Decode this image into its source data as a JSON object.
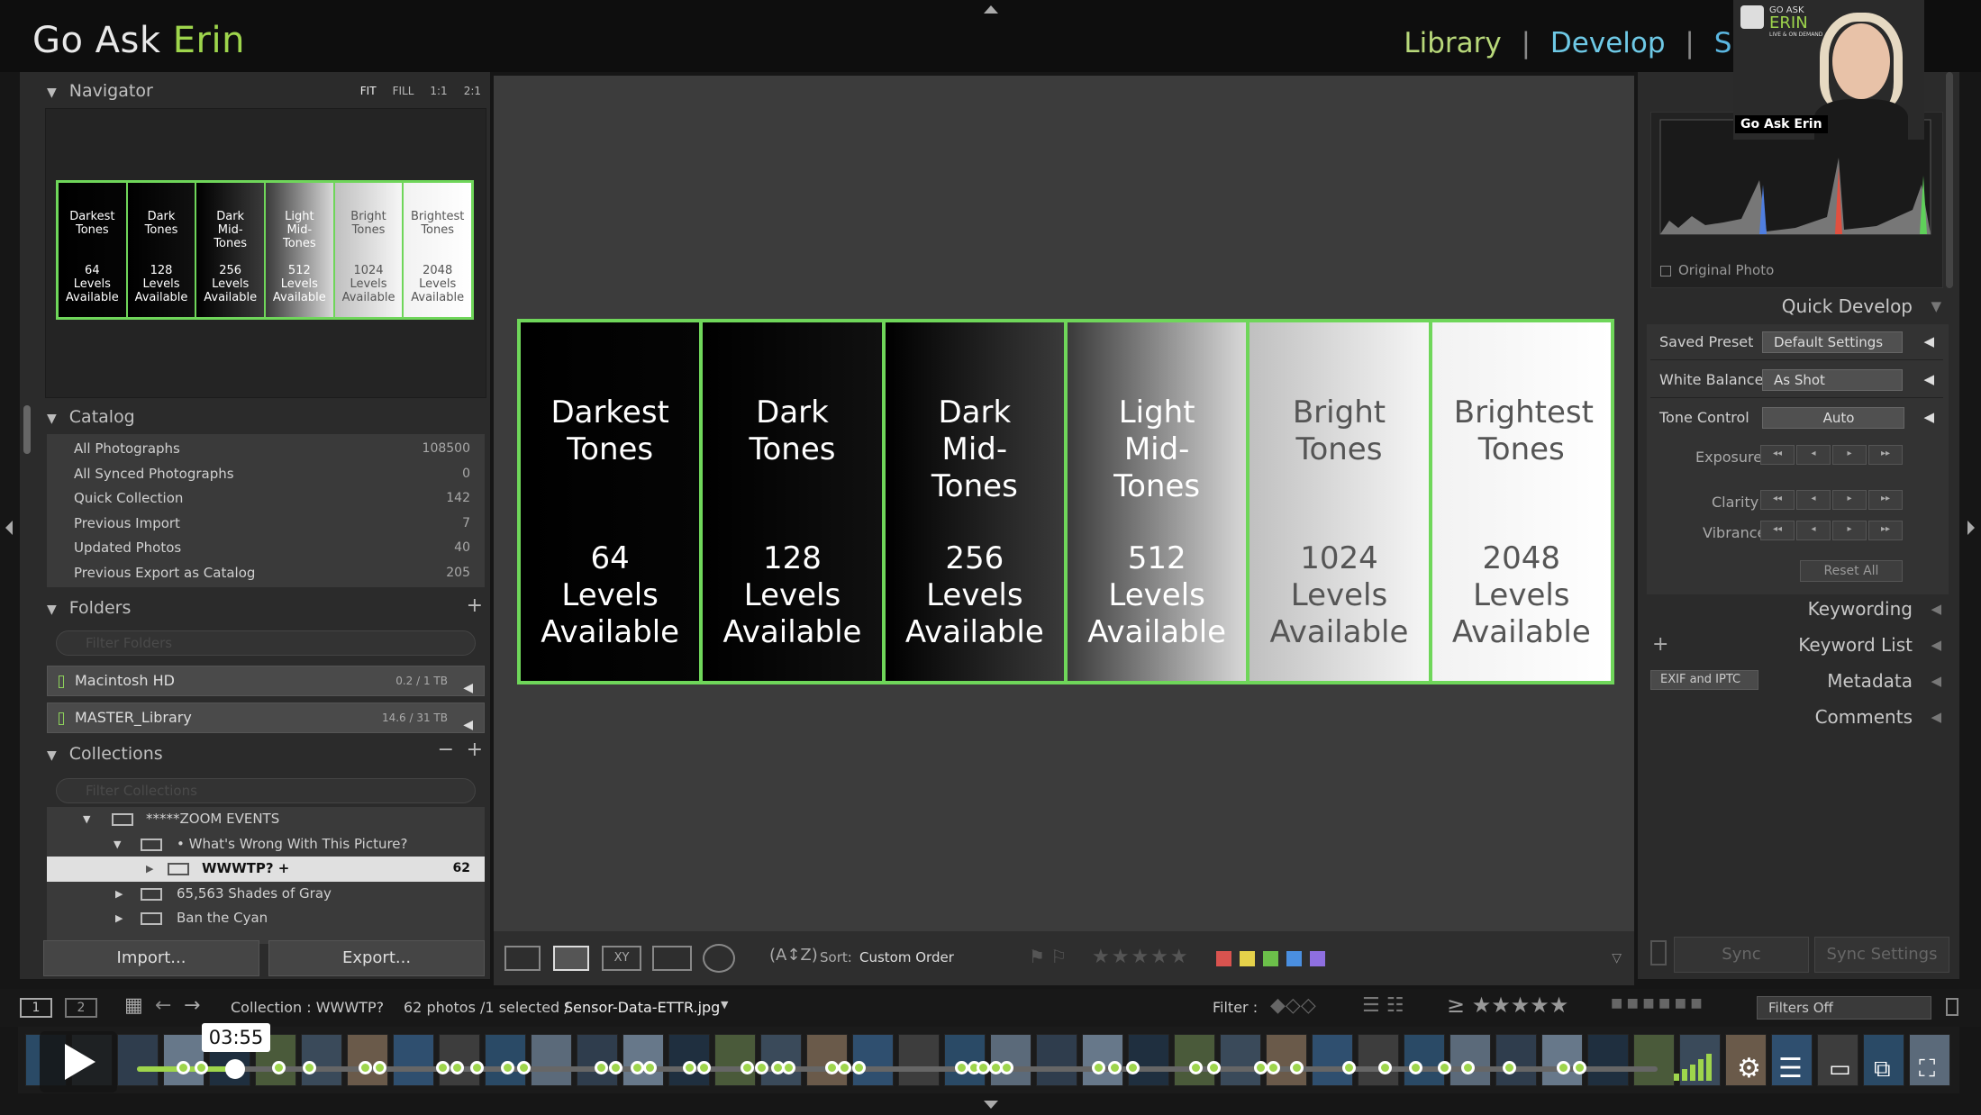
{
  "header": {
    "brand_prefix": "Go Ask",
    "brand_accent": "Erin",
    "modules": [
      "Library",
      "Develop",
      "Sl"
    ],
    "separator": "|"
  },
  "navigator": {
    "title": "Navigator",
    "zoom_options": [
      "FIT",
      "FILL",
      "1:1",
      "2:1"
    ],
    "thumb_columns": [
      {
        "name": "Darkest Tones",
        "levels": "64 Levels Available"
      },
      {
        "name": "Dark Tones",
        "levels": "128 Levels Available"
      },
      {
        "name": "Dark Mid-Tones",
        "levels": "256 Levels Available"
      },
      {
        "name": "Light Mid-Tones",
        "levels": "512 Levels Available"
      },
      {
        "name": "Bright Tones",
        "levels": "1024 Levels Available"
      },
      {
        "name": "Brightest Tones",
        "levels": "2048 Levels Available"
      }
    ]
  },
  "catalog": {
    "title": "Catalog",
    "items": [
      {
        "label": "All Photographs",
        "count": "108500"
      },
      {
        "label": "All Synced Photographs",
        "count": "0"
      },
      {
        "label": "Quick Collection",
        "count": "142"
      },
      {
        "label": "Previous Import",
        "count": "7"
      },
      {
        "label": "Updated Photos",
        "count": "40"
      },
      {
        "label": "Previous Export as Catalog",
        "count": "205"
      }
    ]
  },
  "folders": {
    "title": "Folders",
    "filter_placeholder": "Filter Folders",
    "items": [
      {
        "label": "Macintosh HD",
        "size": "0.2 / 1 TB"
      },
      {
        "label": "MASTER_Library",
        "size": "14.6 / 31 TB"
      }
    ]
  },
  "collections": {
    "title": "Collections",
    "filter_placeholder": "Filter Collections",
    "items": [
      {
        "label": "*****ZOOM EVENTS",
        "count": ""
      },
      {
        "label": "• What's Wrong With This Picture?",
        "count": ""
      },
      {
        "label": "WWWTP? +",
        "count": "62"
      },
      {
        "label": "65,563 Shades of Gray",
        "count": ""
      },
      {
        "label": "Ban the Cyan",
        "count": ""
      }
    ]
  },
  "buttons": {
    "import": "Import...",
    "export": "Export..."
  },
  "main_image": {
    "columns": [
      {
        "name": "Darkest Tones",
        "l1": "64",
        "l2": "Levels",
        "l3": "Available"
      },
      {
        "name": "Dark Tones",
        "l1": "128",
        "l2": "Levels",
        "l3": "Available"
      },
      {
        "name": "Dark Mid-Tones",
        "l1": "256",
        "l2": "Levels",
        "l3": "Available"
      },
      {
        "name": "Light Mid-Tones",
        "l1": "512",
        "l2": "Levels",
        "l3": "Available"
      },
      {
        "name": "Bright Tones",
        "l1": "1024",
        "l2": "Levels",
        "l3": "Available"
      },
      {
        "name": "Brightest Tones",
        "l1": "2048",
        "l2": "Levels",
        "l3": "Available"
      }
    ]
  },
  "toolbar": {
    "sort_label": "Sort:",
    "sort_value": "Custom Order",
    "color_labels": [
      "#d9534f",
      "#e5d14a",
      "#6cc04a",
      "#4a8fe0",
      "#8e6fe0"
    ]
  },
  "right_panel": {
    "original_photo": "Original Photo",
    "quick_develop": "Quick Develop",
    "saved_preset_label": "Saved Preset",
    "saved_preset_value": "Default Settings",
    "white_balance_label": "White Balance",
    "white_balance_value": "As Shot",
    "tone_control_label": "Tone Control",
    "tone_control_value": "Auto",
    "exposure": "Exposure",
    "clarity": "Clarity",
    "vibrance": "Vibrance",
    "reset_all": "Reset All",
    "keywording": "Keywording",
    "keyword_list": "Keyword List",
    "metadata": "Metadata",
    "metadata_preset": "EXIF and IPTC",
    "comments": "Comments",
    "sync": "Sync",
    "sync_settings": "Sync Settings"
  },
  "statusbar": {
    "page1": "1",
    "page2": "2",
    "collection": "Collection : WWWTP?",
    "photos": "62 photos /1 selected /",
    "filename": "Sensor-Data-ETTR.jpg",
    "filter_label": "Filter :",
    "filters_off": "Filters Off"
  },
  "webcam": {
    "name": "Go Ask Erin",
    "logo_line1": "GO ASK",
    "logo_line2": "ERIN",
    "logo_line3": "LIVE & ON DEMAND"
  },
  "player": {
    "time": "03:55",
    "progress": 0.065
  }
}
